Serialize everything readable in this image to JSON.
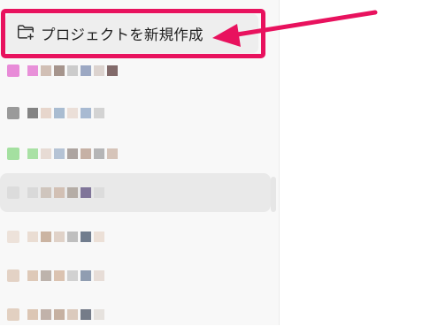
{
  "sidebar": {
    "new_project_label": "プロジェクトを新規作成",
    "projects": [
      {
        "label": "",
        "colors": [
          "#e36fcf",
          "#b0907d",
          "#8b7469",
          "#a8a8a8",
          "#7d8db2",
          "#c4b5ad",
          "#5b3b3b"
        ]
      },
      {
        "label": "",
        "colors": [
          "#5c5c5c",
          "#d9b9a8",
          "#8fa8c4",
          "#e0cbbd",
          "#8ea5c6",
          "#b5b5b5"
        ]
      },
      {
        "label": "",
        "colors": [
          "#8fd98a",
          "#d9c2b6",
          "#9fb1c9",
          "#6f5f58",
          "#b59a8a",
          "#7d7e80",
          "#cbb3a4"
        ]
      },
      {
        "label": "",
        "colors": [
          "#d3d3d3",
          "#b9a799",
          "#c9b2a2",
          "#8b7b70",
          "#5c4e7e",
          "#d1d1d1"
        ]
      },
      {
        "label": "",
        "colors": [
          "#e6d4c7",
          "#a67c5b",
          "#d8c5b8",
          "#8f8f8f",
          "#44546b",
          "#e2ccbc"
        ]
      },
      {
        "label": "",
        "colors": [
          "#d6b9a3",
          "#8c7a6d",
          "#d1b29a",
          "#b0b0b0",
          "#6e7f99",
          "#d9c7bb"
        ]
      },
      {
        "label": "",
        "colors": [
          "#d3b59d",
          "#93786a",
          "#b69a86",
          "#c2a48d",
          "#4a5364",
          "#d7cfc8"
        ]
      }
    ]
  },
  "annotation": {
    "highlight_color": "#e8125e"
  }
}
